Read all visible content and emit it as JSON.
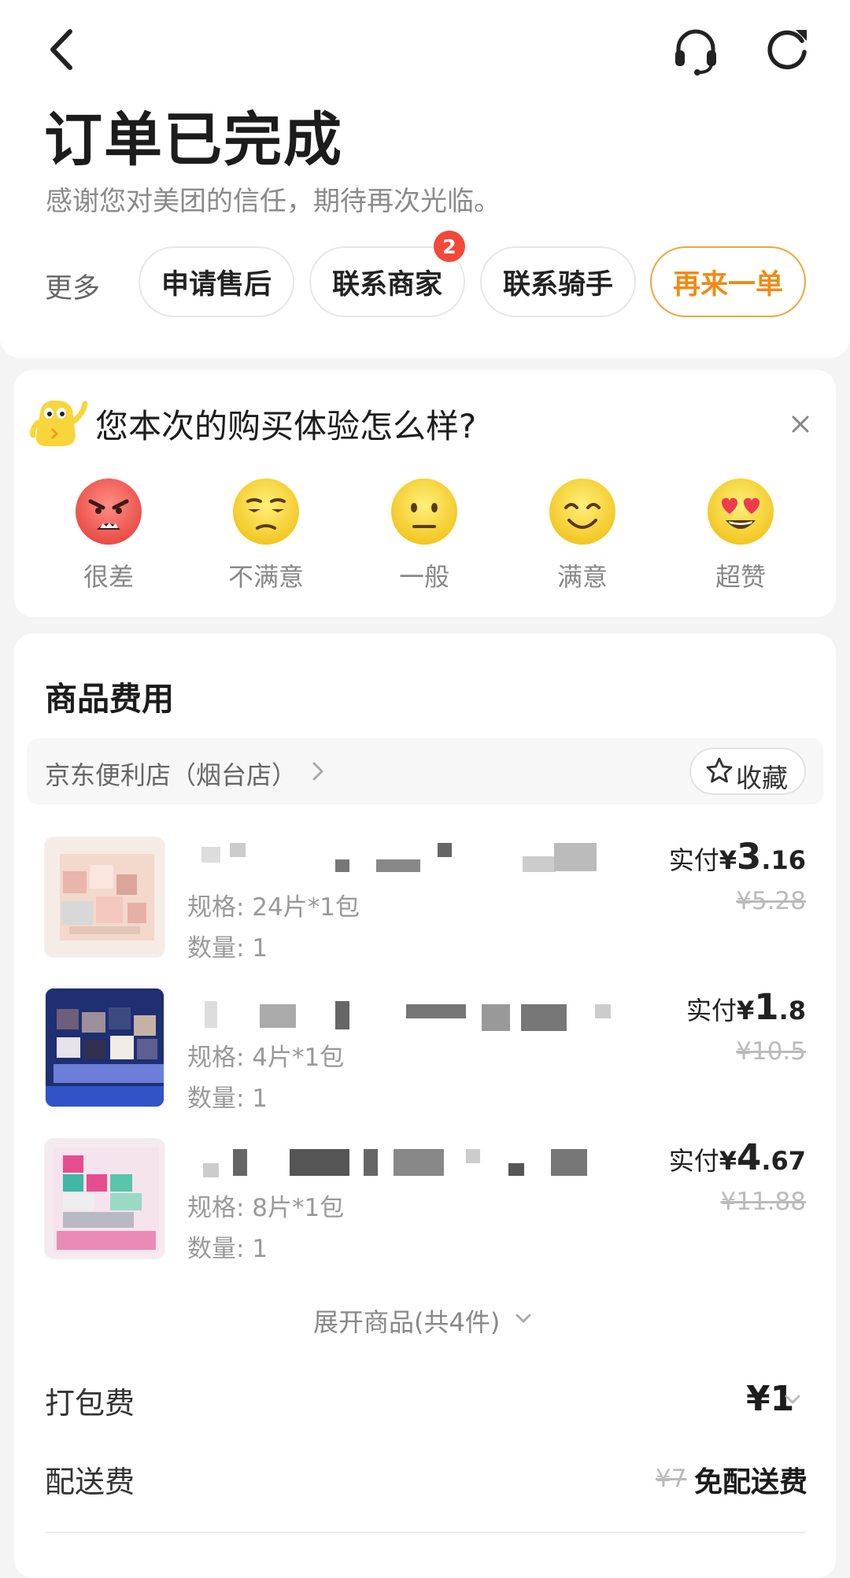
{
  "header": {
    "title": "订单已完成",
    "subtitle": "感谢您对美团的信任，期待再次光临。",
    "icons": [
      "back-arrow-icon",
      "headset-icon",
      "refresh-icon"
    ]
  },
  "actions": {
    "more_label": "更多",
    "buttons": [
      {
        "label": "申请售后"
      },
      {
        "label": "联系商家",
        "badge": "2"
      },
      {
        "label": "联系骑手"
      },
      {
        "label": "再来一单"
      }
    ],
    "accent_color": "#ef8b15",
    "badge_color": "#f2493b"
  },
  "survey": {
    "question": "您本次的购买体验怎么样?",
    "options": [
      {
        "label": "很差",
        "icon": "angry-face-icon"
      },
      {
        "label": "不满意",
        "icon": "unamused-face-icon"
      },
      {
        "label": "一般",
        "icon": "neutral-face-icon"
      },
      {
        "label": "满意",
        "icon": "smiling-face-icon"
      },
      {
        "label": "超赞",
        "icon": "heart-eyes-face-icon"
      }
    ]
  },
  "goods": {
    "section_title": "商品费用",
    "store_name": "京东便利店（烟台店）",
    "favorite_label": "收藏",
    "items": [
      {
        "spec": "规格: 24片*1包",
        "qty": "数量: 1",
        "paid_label": "实付",
        "currency": "¥",
        "paid_int": "3",
        "paid_dec": ".16",
        "original": "¥5.28"
      },
      {
        "spec": "规格: 4片*1包",
        "qty": "数量: 1",
        "paid_label": "实付",
        "currency": "¥",
        "paid_int": "1",
        "paid_dec": ".8",
        "original": "¥10.5"
      },
      {
        "spec": "规格: 8片*1包",
        "qty": "数量: 1",
        "paid_label": "实付",
        "currency": "¥",
        "paid_int": "4",
        "paid_dec": ".67",
        "original": "¥11.88"
      }
    ],
    "expand_label": "展开商品(共4件)"
  },
  "fees": {
    "packing_label": "打包费",
    "packing_value": "¥1",
    "delivery_label": "配送费",
    "delivery_original": "¥7",
    "delivery_value": "免配送费"
  }
}
